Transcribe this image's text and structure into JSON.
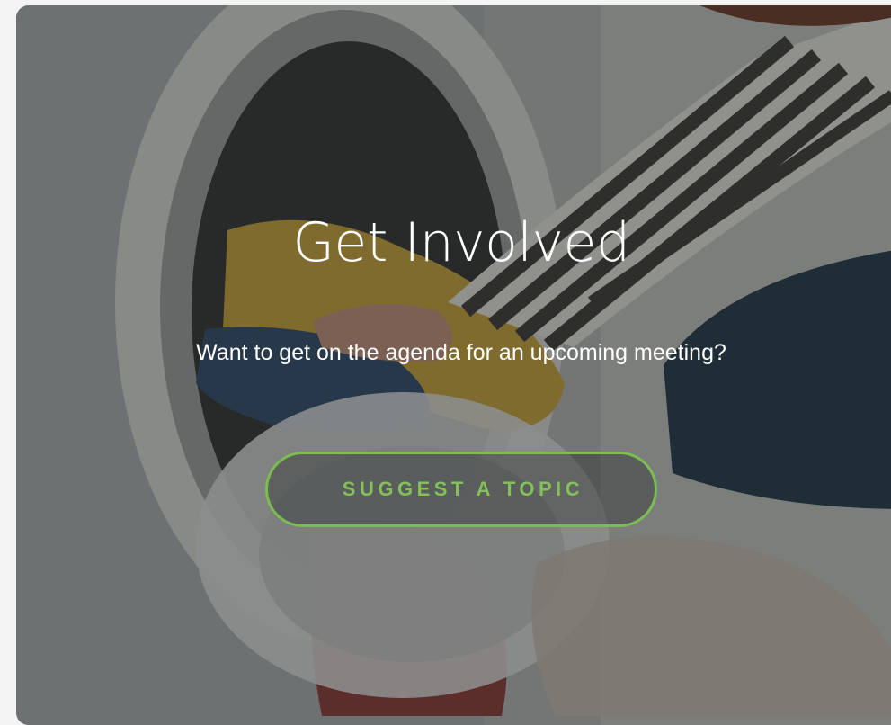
{
  "section": {
    "title": "Get Involved",
    "subtitle": "Want to get on the agenda for an upcoming meeting?",
    "cta_label": "SUGGEST A TOPIC"
  },
  "colors": {
    "accent": "#7bbd4f",
    "text": "#ffffff",
    "overlay": "#1c1e1e"
  },
  "background": {
    "image_subject": "laundry-photo"
  }
}
